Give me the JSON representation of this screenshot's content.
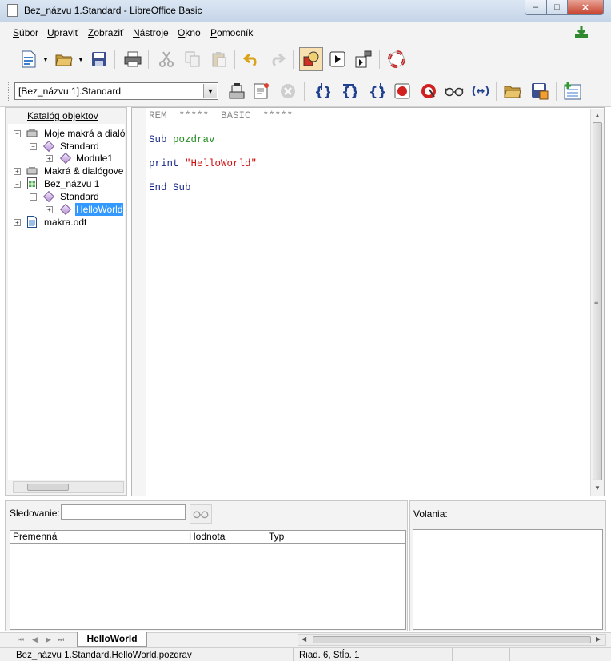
{
  "window": {
    "title": "Bez_názvu 1.Standard - LibreOffice Basic",
    "controls": {
      "minimize": "–",
      "maximize": "□",
      "close": "✕"
    }
  },
  "menu": {
    "items": [
      {
        "label": "Súbor"
      },
      {
        "label": "Upraviť"
      },
      {
        "label": "Zobraziť"
      },
      {
        "label": "Nástroje"
      },
      {
        "label": "Okno"
      },
      {
        "label": "Pomocník"
      }
    ]
  },
  "toolbar1": {
    "icons": [
      "new-document-icon",
      "open-icon",
      "save-icon",
      "print-icon",
      "cut-icon",
      "copy-icon",
      "paste-icon",
      "undo-icon",
      "redo-icon",
      "insert-controls-icon",
      "run-icon",
      "object-bar-icon",
      "help-lifebuoy-icon"
    ]
  },
  "toolbar2": {
    "library_select": "[Bez_názvu 1].Standard",
    "icons": [
      "compile-icon",
      "run-basic-icon",
      "stop-icon",
      "step-into-icon",
      "step-over-icon",
      "step-out-icon",
      "breakpoint-icon",
      "manage-breakpoints-icon",
      "watch-glasses-icon",
      "find-parentheses-icon",
      "open-folder-icon",
      "save-basic-icon",
      "insert-module-icon"
    ]
  },
  "catalog": {
    "title": "Katalóg objektov",
    "tree": [
      {
        "label": "Moje makrá a dialóg",
        "level": 0,
        "expander": "−",
        "icon": "macro-container-icon"
      },
      {
        "label": "Standard",
        "level": 1,
        "expander": "−",
        "icon": "library-diamond-icon"
      },
      {
        "label": "Module1",
        "level": 2,
        "expander": "+",
        "icon": "module-diamond-icon"
      },
      {
        "label": "Makrá & dialógove",
        "level": 0,
        "expander": "+",
        "icon": "macro-container-icon"
      },
      {
        "label": "Bez_názvu 1",
        "level": 0,
        "expander": "−",
        "icon": "spreadsheet-doc-icon"
      },
      {
        "label": "Standard",
        "level": 1,
        "expander": "−",
        "icon": "library-diamond-icon"
      },
      {
        "label": "HelloWorld",
        "level": 2,
        "expander": "+",
        "icon": "module-diamond-icon",
        "selected": true
      },
      {
        "label": "makra.odt",
        "level": 0,
        "expander": "+",
        "icon": "text-doc-icon"
      }
    ]
  },
  "editor": {
    "lines": [
      {
        "text": "REM  *****  BASIC  *****",
        "parts": [
          {
            "t": "REM  *****  BASIC  *****",
            "c": "#8a8a8a"
          }
        ]
      },
      {
        "text": "Sub pozdrav",
        "parts": [
          {
            "t": "Sub ",
            "c": "#1a2a8a"
          },
          {
            "t": "pozdrav",
            "c": "#1f8a1f"
          }
        ]
      },
      {
        "text": "print \"HelloWorld\"",
        "parts": [
          {
            "t": "print ",
            "c": "#1a2a8a"
          },
          {
            "t": "\"HelloWorld\"",
            "c": "#d01010"
          }
        ]
      },
      {
        "text": "End Sub",
        "parts": [
          {
            "t": "End Sub",
            "c": "#1a2a8a"
          }
        ]
      }
    ]
  },
  "watch": {
    "label": "Sledovanie:",
    "value": "",
    "columns": [
      "Premenná",
      "Hodnota",
      "Typ"
    ]
  },
  "calls": {
    "label": "Volania:"
  },
  "tabs": {
    "nav": [
      "⏮",
      "◀",
      "▶",
      "⏭"
    ],
    "items": [
      {
        "label": "HelloWorld",
        "active": true
      }
    ]
  },
  "status": {
    "location": "Bez_názvu 1.Standard.HelloWorld.pozdrav",
    "position": "Riad. 6, Stĺp. 1"
  }
}
